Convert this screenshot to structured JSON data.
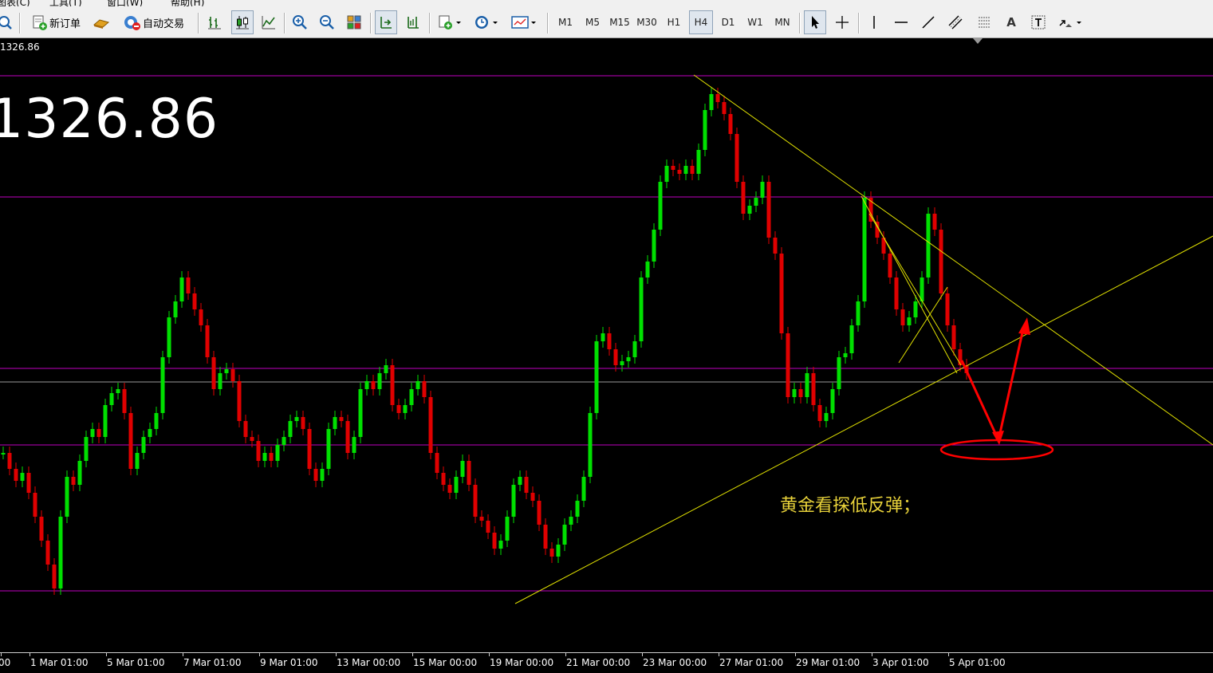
{
  "menu": [
    "图表(C)",
    "工具(T)",
    "窗口(W)",
    "帮助(H)"
  ],
  "toolbar": {
    "new_order_label": "新订单",
    "auto_trade_label": "自动交易",
    "timeframes": [
      "M1",
      "M5",
      "M15",
      "M30",
      "H1",
      "H4",
      "D1",
      "W1",
      "MN"
    ],
    "active_timeframe": "H4",
    "text_tool_label": "A"
  },
  "chart": {
    "symbol_line": "1326.86",
    "big_price": "1326.86",
    "annotation": "黄金看探低反弹；",
    "x_labels": [
      "00",
      "1 Mar 01:00",
      "5 Mar 01:00",
      "7 Mar 01:00",
      "9 Mar 01:00",
      "13 Mar 00:00",
      "15 Mar 00:00",
      "19 Mar 00:00",
      "21 Mar 00:00",
      "23 Mar 00:00",
      "27 Mar 01:00",
      "29 Mar 01:00",
      "3 Apr 01:00",
      "5 Apr 01:00"
    ],
    "colors": {
      "background": "#000000",
      "bull": "#00e000",
      "bear": "#e00000",
      "level": "#c000c0",
      "trend": "#e0e000",
      "arrow": "#ff0000"
    }
  }
}
